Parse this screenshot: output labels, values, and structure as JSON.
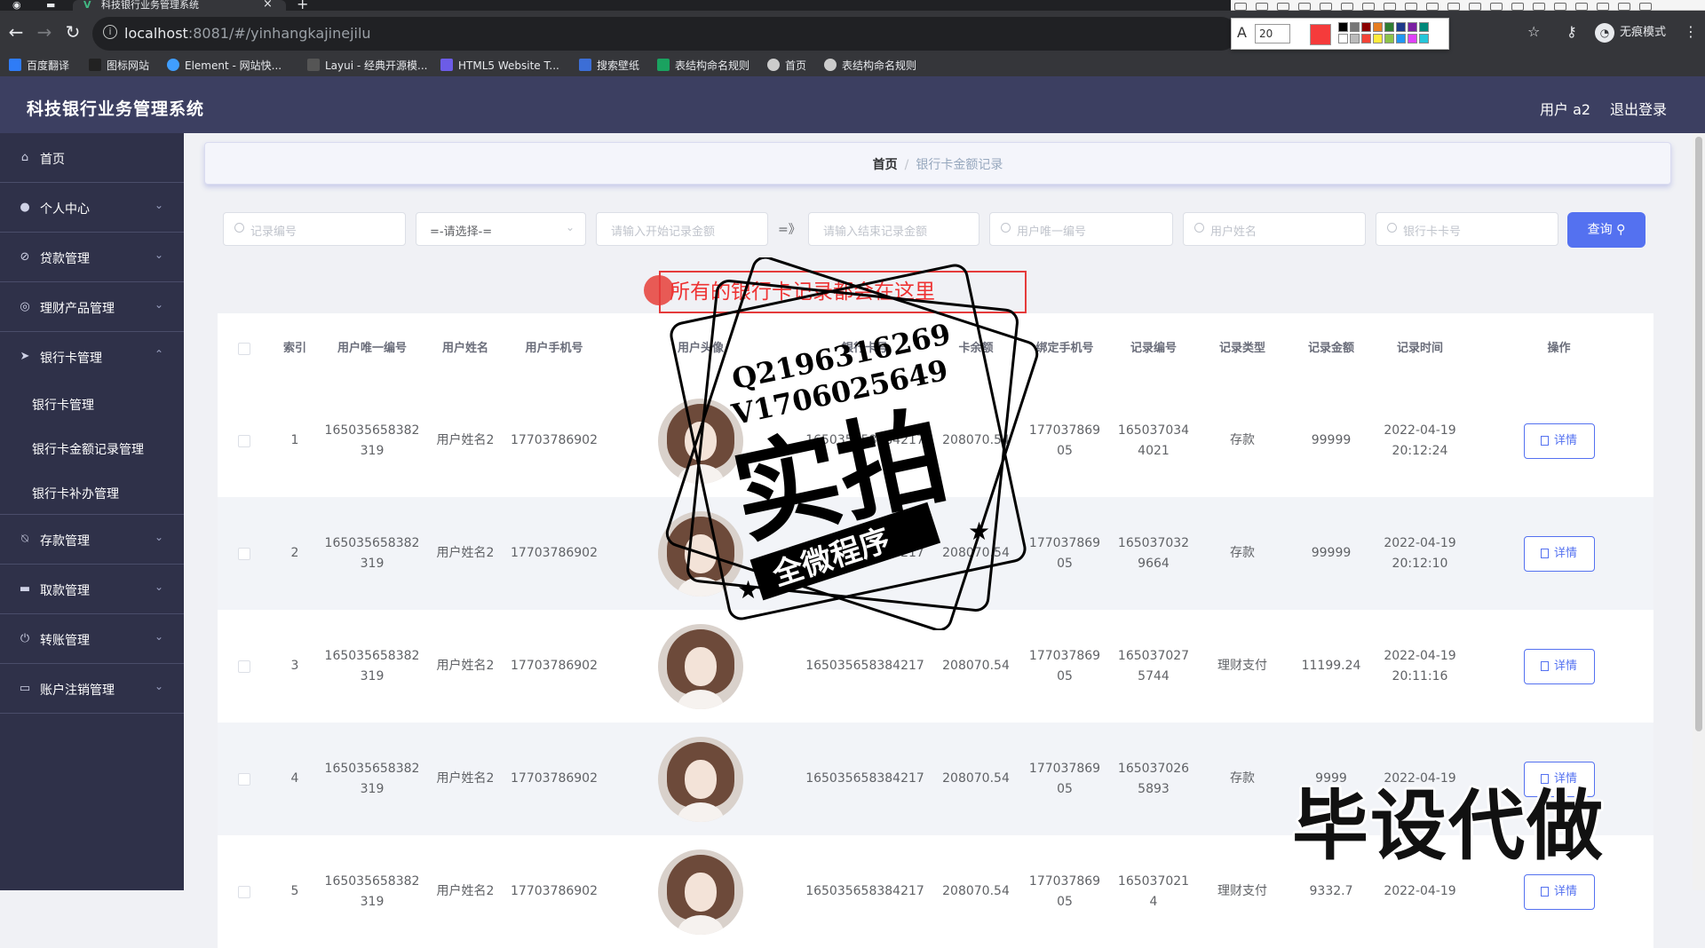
{
  "browser": {
    "tab_title": "科技银行业务管理系统",
    "url_host": "localhost",
    "url_path": ":8081/#/yinhangkajinejilu",
    "incognito_label": "无痕模式",
    "annotation_size": "20",
    "bookmarks": [
      {
        "label": "百度翻译",
        "color": "#2f7cf6"
      },
      {
        "label": "图标网站",
        "color": "#222222"
      },
      {
        "label": "Element - 网站快...",
        "color": "#409eff"
      },
      {
        "label": "Layui - 经典开源模...",
        "color": "#555555"
      },
      {
        "label": "HTML5 Website T...",
        "color": "#6c5ce7"
      },
      {
        "label": "搜索壁纸",
        "color": "#3c6ed6"
      },
      {
        "label": "表结构命名规则",
        "color": "#1aa260"
      },
      {
        "label": "首页",
        "color": "#cccccc"
      },
      {
        "label": "表结构命名规则",
        "color": "#cccccc"
      }
    ]
  },
  "app": {
    "title": "科技银行业务管理系统",
    "user": "用户 a2",
    "logout": "退出登录"
  },
  "sidebar": {
    "items": [
      {
        "label": "首页",
        "icon": "home-icon"
      },
      {
        "label": "个人中心",
        "icon": "user-icon"
      },
      {
        "label": "贷款管理",
        "icon": "loan-icon"
      },
      {
        "label": "理财产品管理",
        "icon": "finance-icon"
      },
      {
        "label": "银行卡管理",
        "icon": "card-icon"
      },
      {
        "label": "存款管理",
        "icon": "deposit-icon"
      },
      {
        "label": "取款管理",
        "icon": "withdraw-icon"
      },
      {
        "label": "转账管理",
        "icon": "transfer-icon"
      },
      {
        "label": "账户注销管理",
        "icon": "account-icon"
      }
    ],
    "sub_items": [
      "银行卡管理",
      "银行卡金额记录管理",
      "银行卡补办管理"
    ]
  },
  "breadcrumb": {
    "home": "首页",
    "current": "银行卡金额记录"
  },
  "filters": {
    "record_no": "记录编号",
    "type_select": "=-请选择-=",
    "amount_start": "请输入开始记录金额",
    "amount_sep": "=》",
    "amount_end": "请输入结束记录金额",
    "user_id": "用户唯一编号",
    "user_name": "用户姓名",
    "card_no": "银行卡卡号",
    "query": "查询"
  },
  "banner": "所有的银行卡记录都会在这里",
  "table": {
    "headers": [
      "索引",
      "用户唯一编号",
      "用户姓名",
      "用户手机号",
      "用户头像",
      "银行卡号",
      "卡余额",
      "绑定手机号",
      "记录编号",
      "记录类型",
      "记录金额",
      "记录时间",
      "操作"
    ],
    "detail_label": "详情",
    "rows": [
      {
        "index": "1",
        "uid": "165035658382319",
        "name": "用户姓名2",
        "phone": "17703786902",
        "card": "165035658384217",
        "balance": "208070.54",
        "bind_phone": "17703786905",
        "record_no": "1650370344021",
        "type": "存款",
        "amount": "99999",
        "date": "2022-04-19",
        "time": "20:12:24"
      },
      {
        "index": "2",
        "uid": "165035658382319",
        "name": "用户姓名2",
        "phone": "17703786902",
        "card": "165035658384217",
        "balance": "208070.54",
        "bind_phone": "17703786905",
        "record_no": "1650370329664",
        "type": "存款",
        "amount": "99999",
        "date": "2022-04-19",
        "time": "20:12:10"
      },
      {
        "index": "3",
        "uid": "165035658382319",
        "name": "用户姓名2",
        "phone": "17703786902",
        "card": "165035658384217",
        "balance": "208070.54",
        "bind_phone": "17703786905",
        "record_no": "1650370275744",
        "type": "理财支付",
        "amount": "11199.24",
        "date": "2022-04-19",
        "time": "20:11:16"
      },
      {
        "index": "4",
        "uid": "165035658382319",
        "name": "用户姓名2",
        "phone": "17703786902",
        "card": "165035658384217",
        "balance": "208070.54",
        "bind_phone": "17703786905",
        "record_no": "1650370265893",
        "type": "存款",
        "amount": "9999",
        "date": "2022-04-19",
        "time": ""
      },
      {
        "index": "5",
        "uid": "165035658382319",
        "name": "用户姓名2",
        "phone": "17703786902",
        "card": "165035658384217",
        "balance": "208070.54",
        "bind_phone": "17703786905",
        "record_no": "1650370214",
        "type": "理财支付",
        "amount": "9332.7",
        "date": "2022-04-19",
        "time": ""
      }
    ]
  },
  "watermark": {
    "qq": "Q2196316269",
    "vx": "V1706025649",
    "main": "实拍",
    "ribbon": "全微程序",
    "corner": "毕设代做"
  }
}
